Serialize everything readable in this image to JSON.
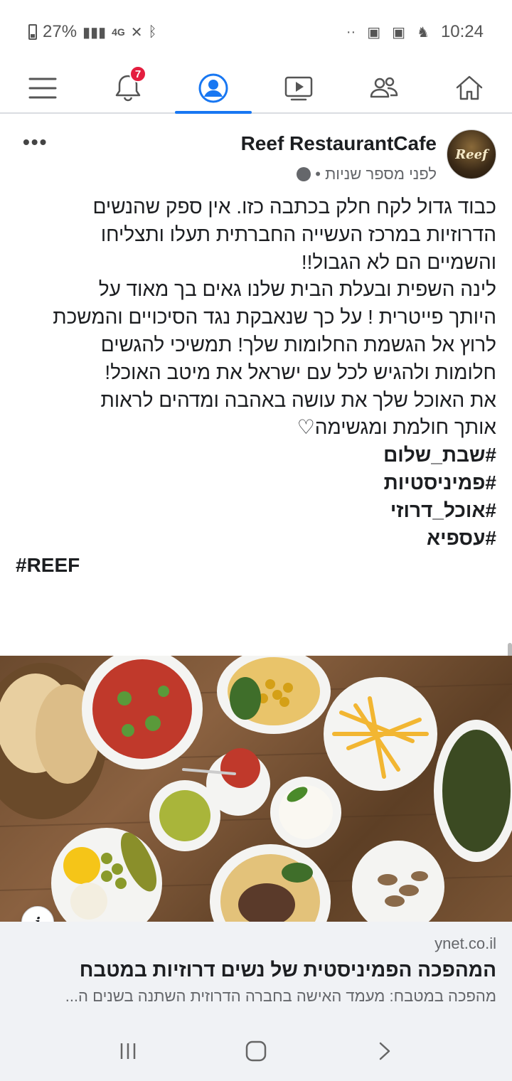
{
  "status_bar": {
    "battery": "27%",
    "network": "4G",
    "time": "10:24"
  },
  "nav": {
    "notifications_badge": "7",
    "active_tab": "profile"
  },
  "post": {
    "page_name": "Reef RestaurantCafe",
    "avatar_text": "Reef",
    "meta_time": "לפני מספר שניות •",
    "more_label": "•••",
    "text_lines": [
      "כבוד גדול לקח חלק בכתבה כזו. אין ספק שהנשים",
      "הדרוזיות במרכז העשייה החברתית תעלו ותצליחו",
      "והשמיים הם לא הגבול!!",
      "לינה השפית ובעלת הבית שלנו גאים בך מאוד על",
      "היותך פייטרית ! על כך שנאבקת נגד הסיכויים והמשכת",
      "לרוץ אל הגשמת החלומות שלך! תמשיכי להגשים",
      "חלומות ולהגיש לכל עם ישראל את מיטב האוכל!",
      "את האוכל שלך את עושה באהבה ומדהים לראות",
      "אותך חולמת ומגשימה♡"
    ],
    "hashtags": [
      "#שבת_שלום",
      "#פמיניסטיות",
      "#אוכל_דרוזי",
      "#עספיא"
    ],
    "hashtag_ltr": "#REEF"
  },
  "link_preview": {
    "domain": "ynet.co.il",
    "title": "המהפכה הפמיניסטית של נשים דרוזיות במטבח",
    "description": "מהפכה במטבח: מעמד האישה בחברה הדרוזית השתנה בשנים ה..."
  },
  "colors": {
    "accent": "#1877f2",
    "badge": "#e41e3f",
    "secondary_text": "#65676b"
  },
  "icons": {
    "nav": [
      "menu-icon",
      "bell-icon",
      "profile-icon",
      "video-icon",
      "groups-icon",
      "home-icon"
    ],
    "bottom": [
      "recents-icon",
      "home-button-icon",
      "back-icon"
    ]
  }
}
